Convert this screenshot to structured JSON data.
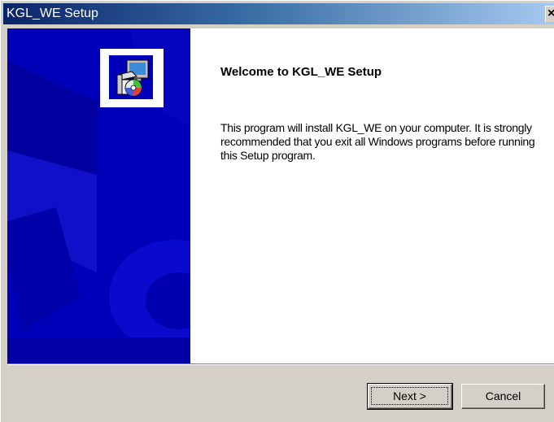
{
  "window": {
    "title": "KGL_WE Setup",
    "close_label": "×"
  },
  "welcome": {
    "title": "Welcome to KGL_WE Setup",
    "body": "This program will install KGL_WE on your computer.  It is strongly recommended that you exit all Windows programs before running this Setup program."
  },
  "buttons": {
    "next": "Next >",
    "cancel": "Cancel"
  },
  "icons": {
    "setup": "setup-installer-icon"
  },
  "colors": {
    "titlebar_start": "#0a246a",
    "titlebar_end": "#a6caf0",
    "banner": "#0000b8",
    "dialog_face": "#d4d0c8"
  }
}
